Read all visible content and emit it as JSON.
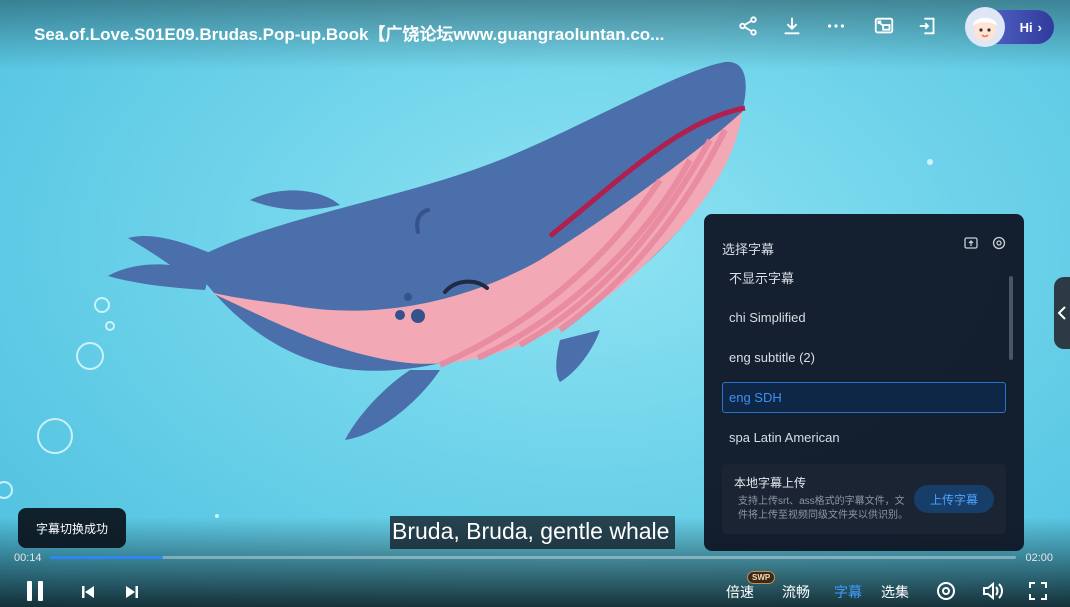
{
  "video": {
    "title": "Sea.of.Love.S01E09.Brudas.Pop-up.Book【广饶论坛www.guangraoluntan.co...",
    "subtitle_line": "Bruda, Bruda, gentle whale",
    "current_time": "00:14",
    "duration": "02:00",
    "progress_fraction": 0.117
  },
  "top_bar": {
    "icons": [
      "share-icon",
      "download-icon",
      "more-icon",
      "picture-in-picture-icon",
      "screen-cast-icon"
    ],
    "hi_label": "Hi"
  },
  "subtitle_panel": {
    "title": "选择字幕",
    "tools": [
      "subtitle-help-icon",
      "subtitle-settings-icon"
    ],
    "options": [
      "不显示字幕",
      "chi Simplified",
      "eng subtitle (2)",
      "eng SDH",
      "spa Latin American"
    ],
    "selected": "eng SDH",
    "upload": {
      "title": "本地字幕上传",
      "description": "支持上传srt、ass格式的字幕文件，文件将上传至视频同级文件夹以供识别。",
      "button": "上传字幕"
    }
  },
  "toast": "字幕切换成功",
  "controls": {
    "speed": "倍速",
    "swp_badge": "SWP",
    "quality": "流畅",
    "subtitles": "字幕",
    "episodes": "选集"
  },
  "colors": {
    "accent": "#2f86f0",
    "panel_bg": "#101826",
    "water": "#6fd3ea"
  }
}
